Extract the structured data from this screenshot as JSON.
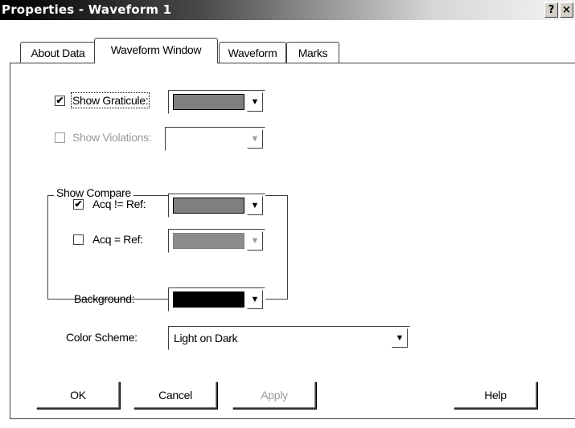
{
  "window": {
    "title": "Properties - Waveform 1",
    "help_glyph": "?",
    "close_glyph": "×"
  },
  "tabs": [
    {
      "label": "About Data",
      "active": false
    },
    {
      "label": "Waveform Window",
      "active": true
    },
    {
      "label": "Waveform",
      "active": false
    },
    {
      "label": "Marks",
      "active": false
    }
  ],
  "settings": {
    "show_graticule": {
      "label": "Show Graticule:",
      "checked": true,
      "check_glyph": "✔",
      "color": "#7f7f7f"
    },
    "show_violations": {
      "label": "Show Violations:",
      "checked": false,
      "disabled": true,
      "color": "#ffffff"
    },
    "show_compare": {
      "group_label": "Show Compare",
      "acq_not_ref": {
        "label": "Acq != Ref:",
        "checked": true,
        "check_glyph": "✔",
        "color": "#7f7f7f"
      },
      "acq_eq_ref": {
        "label": "Acq = Ref:",
        "checked": false,
        "disabled": true,
        "color": "#8c8c8c"
      }
    },
    "background": {
      "label": "Background:",
      "color": "#000000"
    },
    "color_scheme": {
      "label": "Color Scheme:",
      "value": "Light on Dark"
    }
  },
  "dropdown_arrow": "▼",
  "buttons": {
    "ok": "OK",
    "cancel": "Cancel",
    "apply": "Apply",
    "help": "Help"
  }
}
